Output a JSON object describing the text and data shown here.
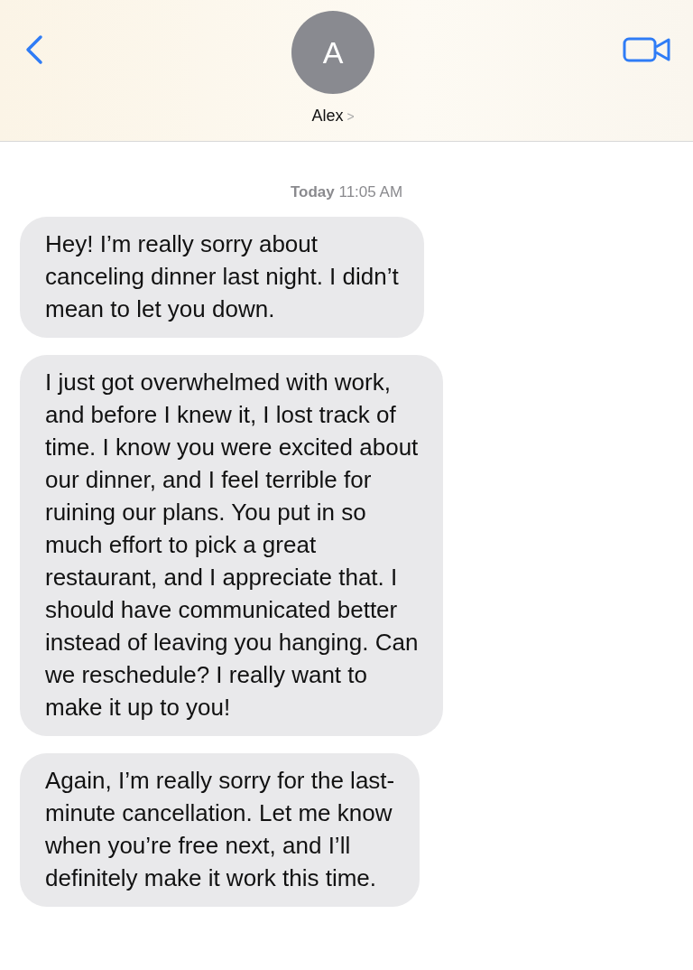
{
  "header": {
    "avatar_letter": "A",
    "contact_name": "Alex",
    "chevron": ">"
  },
  "timestamp": "**Today** 11:05 AM",
  "messages": [
    {
      "text": "Hey! I’m really sorry about\ncanceling dinner last night. I didn’t\nmean to let you down."
    },
    {
      "text": "I just got overwhelmed with work,\nand before I knew it, I lost track of\ntime. I know you were excited about\nour dinner, and I feel terrible for\nruining our plans. You put in so\nmuch effort to pick a great\nrestaurant, and I appreciate that. I\nshould have communicated better\ninstead of leaving you hanging. Can\nwe reschedule? I really want to\nmake it up to you!"
    },
    {
      "text": "Again, I’m really sorry for the last-\nminute cancellation. Let me know\nwhen you’re free next, and I’ll\ndefinitely make it work this time."
    }
  ]
}
